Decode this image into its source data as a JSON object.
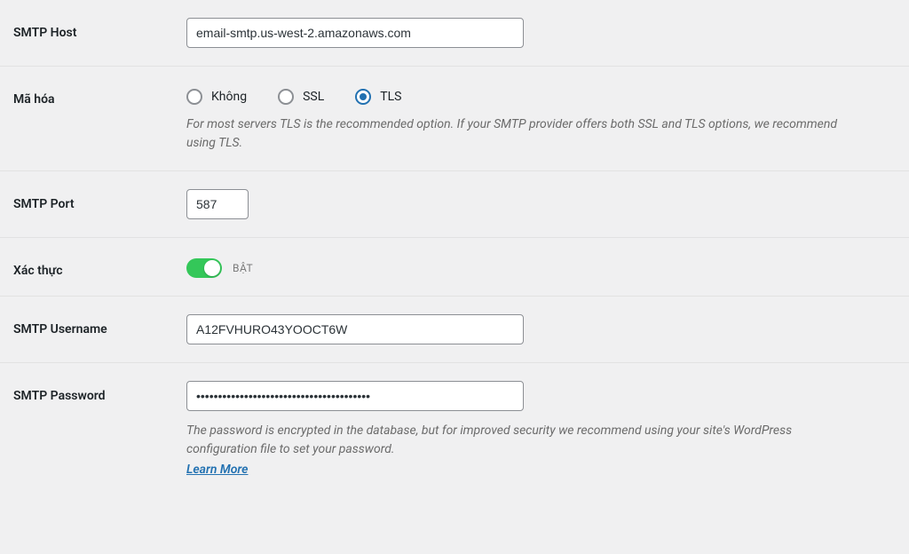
{
  "fields": {
    "smtp_host": {
      "label": "SMTP Host",
      "value": "email-smtp.us-west-2.amazonaws.com"
    },
    "encryption": {
      "label": "Mã hóa",
      "options": {
        "none": "Không",
        "ssl": "SSL",
        "tls": "TLS"
      },
      "help": "For most servers TLS is the recommended option. If your SMTP provider offers both SSL and TLS options, we recommend using TLS."
    },
    "smtp_port": {
      "label": "SMTP Port",
      "value": "587"
    },
    "auth": {
      "label": "Xác thực",
      "status": "BẬT"
    },
    "smtp_username": {
      "label": "SMTP Username",
      "value": "A12FVHURO43YOOCT6W"
    },
    "smtp_password": {
      "label": "SMTP Password",
      "value": "••••••••••••••••••••••••••••••••••••••••",
      "help": "The password is encrypted in the database, but for improved security we recommend using your site's WordPress configuration file to set your password.",
      "learn_more": "Learn More"
    }
  }
}
